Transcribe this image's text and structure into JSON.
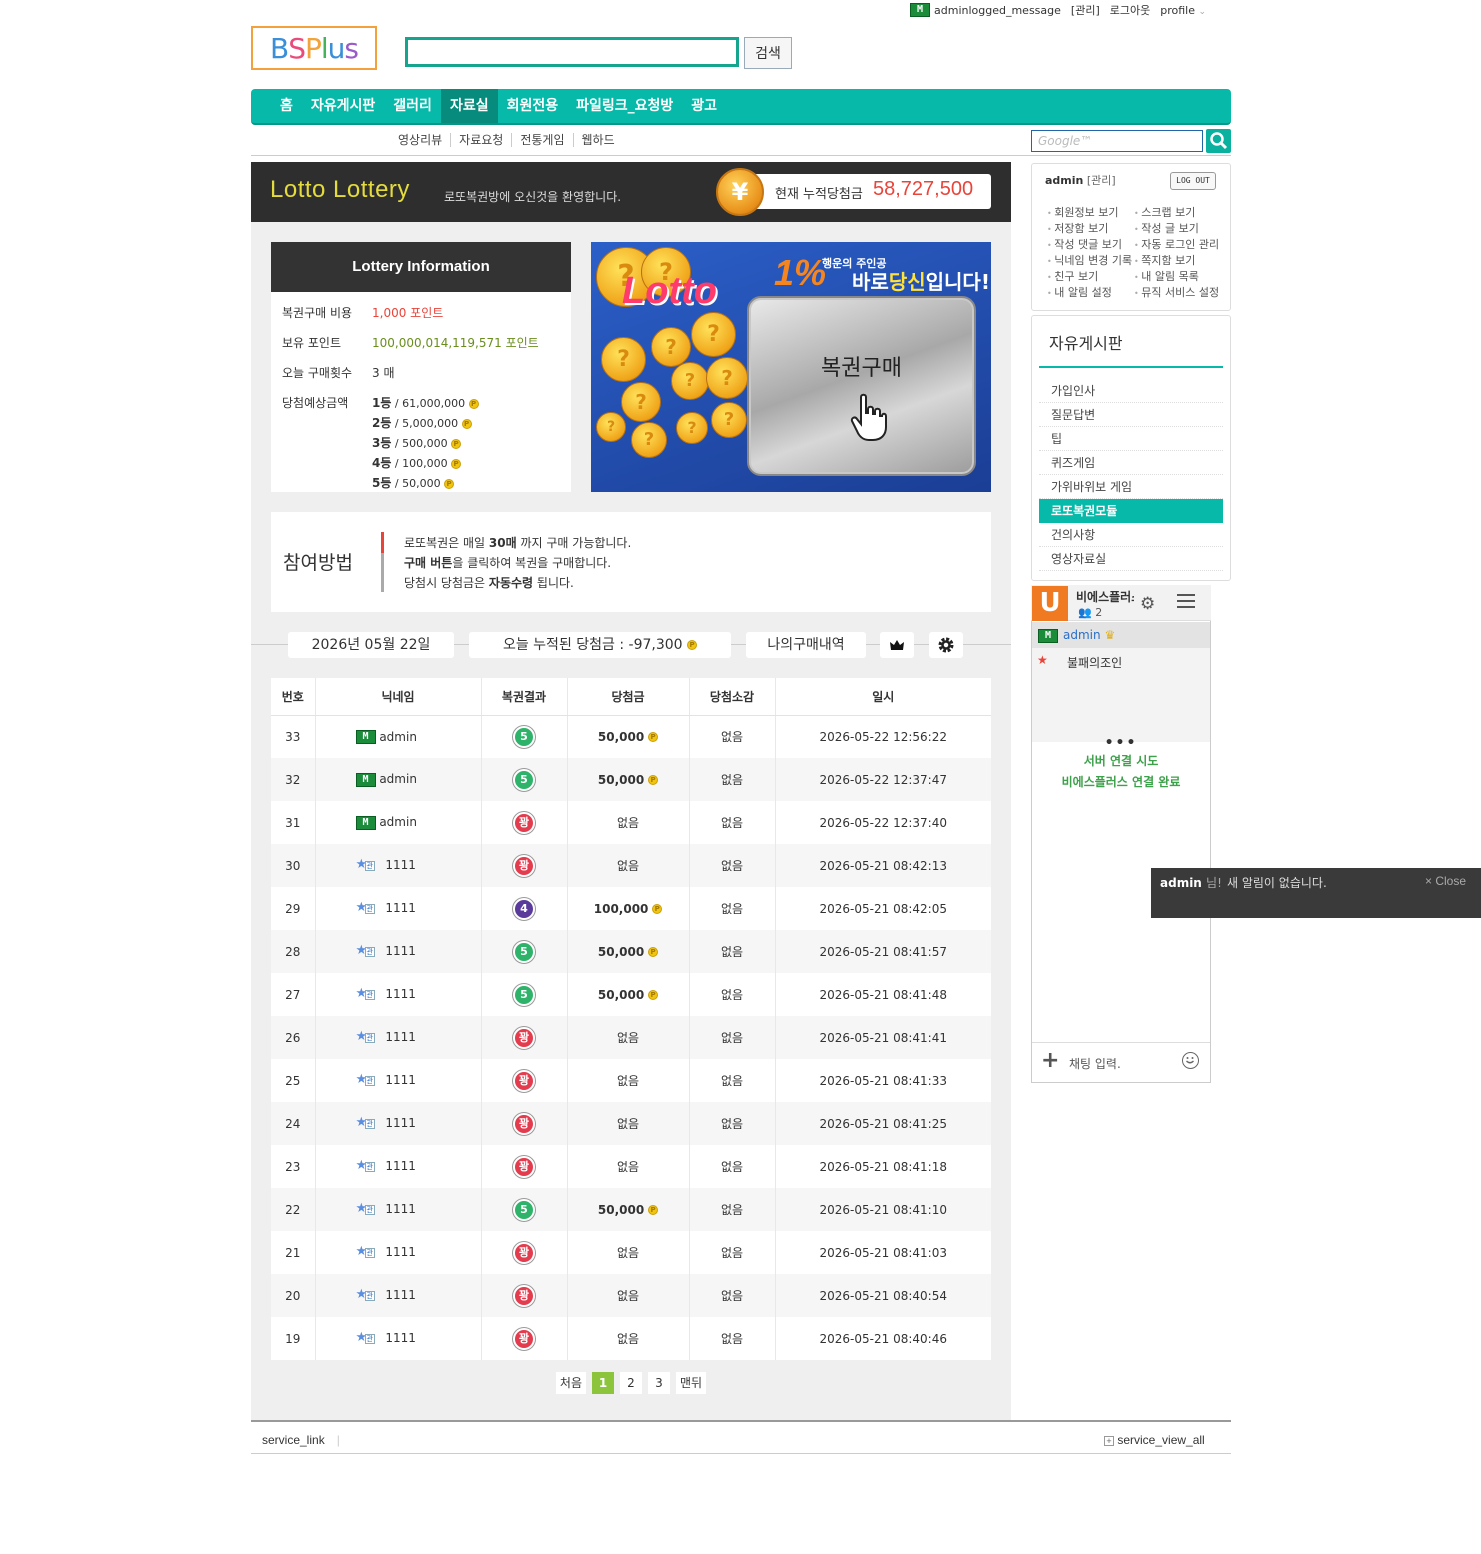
{
  "topbar": {
    "login_message": "adminlogged_message",
    "admin_link": "[관리]",
    "logout_link": "로그아웃",
    "profile_link": "profile"
  },
  "logo": {
    "text": "BSPlus"
  },
  "search": {
    "button_label": "검색",
    "google_placeholder": "Google™"
  },
  "gnb": {
    "items": [
      "홈",
      "자유게시판",
      "갤러리",
      "자료실",
      "회원전용",
      "파일링크_요청방",
      "광고"
    ],
    "active": "자료실"
  },
  "subnav": {
    "items": [
      "영상리뷰",
      "자료요청",
      "전통게임",
      "웹하드"
    ]
  },
  "lotto": {
    "title": "Lotto Lottery",
    "welcome": "로또복권방에 오신것을 환영합니다.",
    "coin_symbol": "¥",
    "jackpot_label": "현재 누적당첨금",
    "jackpot_value": "58,727,500"
  },
  "info": {
    "header": "Lottery Information",
    "rows": [
      {
        "label": "복권구매 비용",
        "value": "1,000 포인트",
        "color": "#e8443a"
      },
      {
        "label": "보유 포인트",
        "value": "100,000,014,119,571 포인트",
        "color": "#6a8e1e"
      },
      {
        "label": "오늘 구매횟수",
        "value": "3 매",
        "color": "#333333"
      }
    ],
    "prize_label": "당첨예상금액",
    "prizes": [
      {
        "rank": "1등",
        "amount": "61,000,000"
      },
      {
        "rank": "2등",
        "amount": "5,000,000"
      },
      {
        "rank": "3등",
        "amount": "500,000"
      },
      {
        "rank": "4등",
        "amount": "100,000"
      },
      {
        "rank": "5등",
        "amount": "50,000"
      }
    ]
  },
  "banner": {
    "logo": "Lotto",
    "percent": "1%",
    "sub": "행운의 주인공",
    "main_pre": "바로",
    "main_em": "당신",
    "main_post": "입니다!",
    "buy_label": "복권구매"
  },
  "howto": {
    "title": "참여방법",
    "line1_pre": "로또복권은 매일 ",
    "line1_b": "30매",
    "line1_post": " 까지 구매 가능합니다.",
    "line2_b": "구매 버튼",
    "line2_post": "을 클릭하여 복권을 구매합니다.",
    "line3_pre": "당첨시 당첨금은 ",
    "line3_b": "자동수령",
    "line3_post": " 됩니다."
  },
  "status": {
    "date": "2026년 05월 22일",
    "today_total": "오늘 누적된 당첨금 : -97,300",
    "my_history": "나의구매내역"
  },
  "table": {
    "headers": [
      "번호",
      "닉네임",
      "복권결과",
      "당첨금",
      "당첨소감",
      "일시"
    ],
    "rows": [
      {
        "no": "33",
        "badge": "M",
        "nick": "admin",
        "result": "5",
        "rtype": "r5",
        "prize": "50,000",
        "win": true,
        "comment": "없음",
        "date": "2026-05-22 12:56:22"
      },
      {
        "no": "32",
        "badge": "M",
        "nick": "admin",
        "result": "5",
        "rtype": "r5",
        "prize": "50,000",
        "win": true,
        "comment": "없음",
        "date": "2026-05-22 12:37:47"
      },
      {
        "no": "31",
        "badge": "M",
        "nick": "admin",
        "result": "꽝",
        "rtype": "rx",
        "prize": "없음",
        "win": false,
        "comment": "없음",
        "date": "2026-05-22 12:37:40"
      },
      {
        "no": "30",
        "badge": "S",
        "nick": "1111",
        "result": "꽝",
        "rtype": "rx",
        "prize": "없음",
        "win": false,
        "comment": "없음",
        "date": "2026-05-21 08:42:13"
      },
      {
        "no": "29",
        "badge": "S",
        "nick": "1111",
        "result": "4",
        "rtype": "r4",
        "prize": "100,000",
        "win": true,
        "comment": "없음",
        "date": "2026-05-21 08:42:05"
      },
      {
        "no": "28",
        "badge": "S",
        "nick": "1111",
        "result": "5",
        "rtype": "r5",
        "prize": "50,000",
        "win": true,
        "comment": "없음",
        "date": "2026-05-21 08:41:57"
      },
      {
        "no": "27",
        "badge": "S",
        "nick": "1111",
        "result": "5",
        "rtype": "r5",
        "prize": "50,000",
        "win": true,
        "comment": "없음",
        "date": "2026-05-21 08:41:48"
      },
      {
        "no": "26",
        "badge": "S",
        "nick": "1111",
        "result": "꽝",
        "rtype": "rx",
        "prize": "없음",
        "win": false,
        "comment": "없음",
        "date": "2026-05-21 08:41:41"
      },
      {
        "no": "25",
        "badge": "S",
        "nick": "1111",
        "result": "꽝",
        "rtype": "rx",
        "prize": "없음",
        "win": false,
        "comment": "없음",
        "date": "2026-05-21 08:41:33"
      },
      {
        "no": "24",
        "badge": "S",
        "nick": "1111",
        "result": "꽝",
        "rtype": "rx",
        "prize": "없음",
        "win": false,
        "comment": "없음",
        "date": "2026-05-21 08:41:25"
      },
      {
        "no": "23",
        "badge": "S",
        "nick": "1111",
        "result": "꽝",
        "rtype": "rx",
        "prize": "없음",
        "win": false,
        "comment": "없음",
        "date": "2026-05-21 08:41:18"
      },
      {
        "no": "22",
        "badge": "S",
        "nick": "1111",
        "result": "5",
        "rtype": "r5",
        "prize": "50,000",
        "win": true,
        "comment": "없음",
        "date": "2026-05-21 08:41:10"
      },
      {
        "no": "21",
        "badge": "S",
        "nick": "1111",
        "result": "꽝",
        "rtype": "rx",
        "prize": "없음",
        "win": false,
        "comment": "없음",
        "date": "2026-05-21 08:41:03"
      },
      {
        "no": "20",
        "badge": "S",
        "nick": "1111",
        "result": "꽝",
        "rtype": "rx",
        "prize": "없음",
        "win": false,
        "comment": "없음",
        "date": "2026-05-21 08:40:54"
      },
      {
        "no": "19",
        "badge": "S",
        "nick": "1111",
        "result": "꽝",
        "rtype": "rx",
        "prize": "없음",
        "win": false,
        "comment": "없음",
        "date": "2026-05-21 08:40:46"
      }
    ]
  },
  "pager": {
    "first": "처음",
    "pages": [
      "1",
      "2",
      "3"
    ],
    "current": "1",
    "last": "맨뒤"
  },
  "footer": {
    "left": "service_link",
    "right": "service_view_all"
  },
  "login_box": {
    "user": "admin",
    "admin_link": "[관리]",
    "logout": "LOG OUT",
    "links_left": [
      "회원정보 보기",
      "저장함 보기",
      "작성 댓글 보기",
      "닉네임 변경 기록",
      "친구 보기",
      "내 알림 설정"
    ],
    "links_right": [
      "스크랩 보기",
      "작성 글 보기",
      "자동 로그인 관리",
      "쪽지함 보기",
      "내 알림 목록",
      "뮤직 서비스 설정"
    ]
  },
  "board": {
    "title": "자유게시판",
    "items": [
      "가입인사",
      "질문답변",
      "팁",
      "퀴즈게임",
      "가위바위보 게임",
      "로또복권모듈",
      "건의사항",
      "영상자료실"
    ],
    "active": "로또복권모듈"
  },
  "chat": {
    "logo": "U",
    "name": "비에스플러스",
    "count": "2",
    "users": [
      "admin",
      "불패의조인"
    ],
    "dots": "•••",
    "sys1": "서버 연결 시도",
    "sys2": "비에스플러스 연결 완료",
    "input_placeholder": "채팅 입력."
  },
  "toast": {
    "user": "admin",
    "suffix": "님!",
    "message": "새 알림이 없습니다.",
    "close": "× Close"
  },
  "colors": {
    "accent": "#07b9a9",
    "jackpot": "#e8443a",
    "win_green": "#2fb36a",
    "lose_red": "#e23c4e"
  }
}
